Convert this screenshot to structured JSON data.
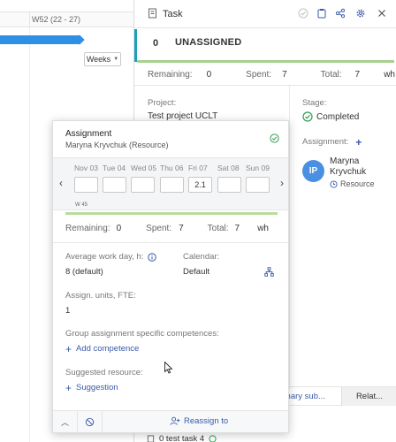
{
  "gantt": {
    "week_label": "W52 (22 - 27)",
    "scale_dropdown": "Weeks"
  },
  "task_panel": {
    "title": "Task",
    "status_number": "0",
    "status": "UNASSIGNED",
    "stats": {
      "remaining_label": "Remaining:",
      "remaining_value": "0",
      "spent_label": "Spent:",
      "spent_value": "7",
      "total_label": "Total:",
      "total_value": "7",
      "unit": "wh"
    },
    "progress_fraction": 1.0,
    "project_label": "Project:",
    "project_value": "Test project UCLT",
    "stage_label": "Stage:",
    "stage_value": "Completed",
    "assignment_label": "Assignment:",
    "resource": {
      "initials": "IP",
      "name": "Maryna Kryvchuk",
      "type": "Resource"
    },
    "tabs": {
      "summary": "mmary sub...",
      "related": "Relat..."
    },
    "subtask": "0 test task 4",
    "colors": {
      "accent": "#17a2b8",
      "progress": "#a9d18e",
      "link": "#3a5ba9",
      "avatar": "#4a90e2"
    }
  },
  "assignment_popup": {
    "title": "Assignment",
    "subtitle": "Maryna Kryvchuk (Resource)",
    "days": [
      {
        "name": "Nov 03",
        "value": ""
      },
      {
        "name": "Tue 04",
        "value": ""
      },
      {
        "name": "Wed 05",
        "value": ""
      },
      {
        "name": "Thu 06",
        "value": ""
      },
      {
        "name": "Fri 07",
        "value": "2.1"
      },
      {
        "name": "Sat 08",
        "value": ""
      },
      {
        "name": "Sun 09",
        "value": ""
      }
    ],
    "week_number": "W 45",
    "progress_fraction": 1.0,
    "stats": {
      "remaining_label": "Remaining:",
      "remaining_value": "0",
      "spent_label": "Spent:",
      "spent_value": "7",
      "total_label": "Total:",
      "total_value": "7",
      "unit": "wh"
    },
    "avg_workday_label": "Average work day, h:",
    "avg_workday_value": "8 (default)",
    "calendar_label": "Calendar:",
    "calendar_value": "Default",
    "units_label": "Assign. units, FTE:",
    "units_value": "1",
    "competences_label": "Group assignment specific competences:",
    "add_competence": "Add competence",
    "suggested_label": "Suggested resource:",
    "add_suggestion": "Suggestion",
    "reassign": "Reassign to"
  }
}
